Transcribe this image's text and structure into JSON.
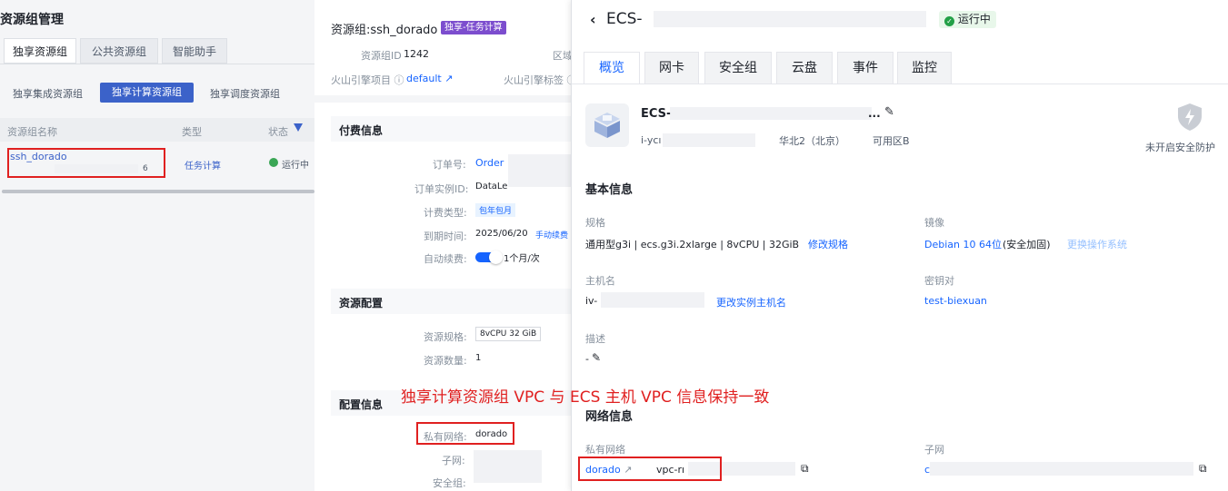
{
  "left": {
    "title": "资源组管理",
    "tabs": [
      "独享资源组",
      "公共资源组",
      "智能助手"
    ],
    "subtabs": [
      "独享集成资源组",
      "独享计算资源组",
      "独享调度资源组"
    ],
    "columns": {
      "name": "资源组名称",
      "type": "类型",
      "status": "状态"
    },
    "row": {
      "name": "ssh_dorado",
      "id_tail": "6",
      "type": "任务计算",
      "status": "运行中"
    }
  },
  "mid": {
    "title": "资源组:ssh_dorado",
    "tag": "独享-任务计算",
    "id_label": "资源组ID",
    "id_value": "1242",
    "region_label": "区域",
    "project_label": "火山引擎项目",
    "project_value": "default",
    "tag_label": "火山引擎标签",
    "billing": {
      "title": "付费信息",
      "order_label": "订单号:",
      "order_value": "Order",
      "instance_label": "订单实例ID:",
      "instance_value": "DataLe",
      "type_label": "计费类型:",
      "type_value": "包年包月",
      "expire_label": "到期时间:",
      "expire_value": "2025/06/20",
      "renew_link": "手动续费",
      "auto_label": "自动续费:",
      "auto_value": "1个月/次"
    },
    "resource": {
      "title": "资源配置",
      "spec_label": "资源规格:",
      "spec_value": "8vCPU 32 GiB",
      "count_label": "资源数量:",
      "count_value": "1"
    },
    "config": {
      "title": "配置信息",
      "vpc_label": "私有网络:",
      "vpc_value": "dorado",
      "subnet_label": "子网:",
      "sg_label": "安全组:"
    }
  },
  "annotation": "独享计算资源组 VPC 与 ECS 主机 VPC 信息保持一致",
  "ecs": {
    "title": "ECS-",
    "status": "运行中",
    "tabs": [
      "概览",
      "网卡",
      "安全组",
      "云盘",
      "事件",
      "监控"
    ],
    "instance_name": "ECS-",
    "instance_name_suffix": "...",
    "instance_id": "i-ycı",
    "region": "华北2（北京）",
    "zone": "可用区B",
    "security": "未开启安全防护",
    "basic_title": "基本信息",
    "spec_label": "规格",
    "spec_value": "通用型g3i | ecs.g3i.2xlarge | 8vCPU | 32GiB",
    "spec_link": "修改规格",
    "image_label": "镜像",
    "image_value": "Debian 10 64位",
    "image_note": "(安全加固)",
    "image_link": "更换操作系统",
    "host_label": "主机名",
    "host_value": "iv-",
    "host_link": "更改实例主机名",
    "key_label": "密钥对",
    "key_value": "test-biexuan",
    "desc_label": "描述",
    "desc_value": "-",
    "net_title": "网络信息",
    "vpc_label": "私有网络",
    "vpc_value": "dorado",
    "vpc_id": "vpc-rı",
    "subnet_label": "子网",
    "subnet_value": "c"
  }
}
